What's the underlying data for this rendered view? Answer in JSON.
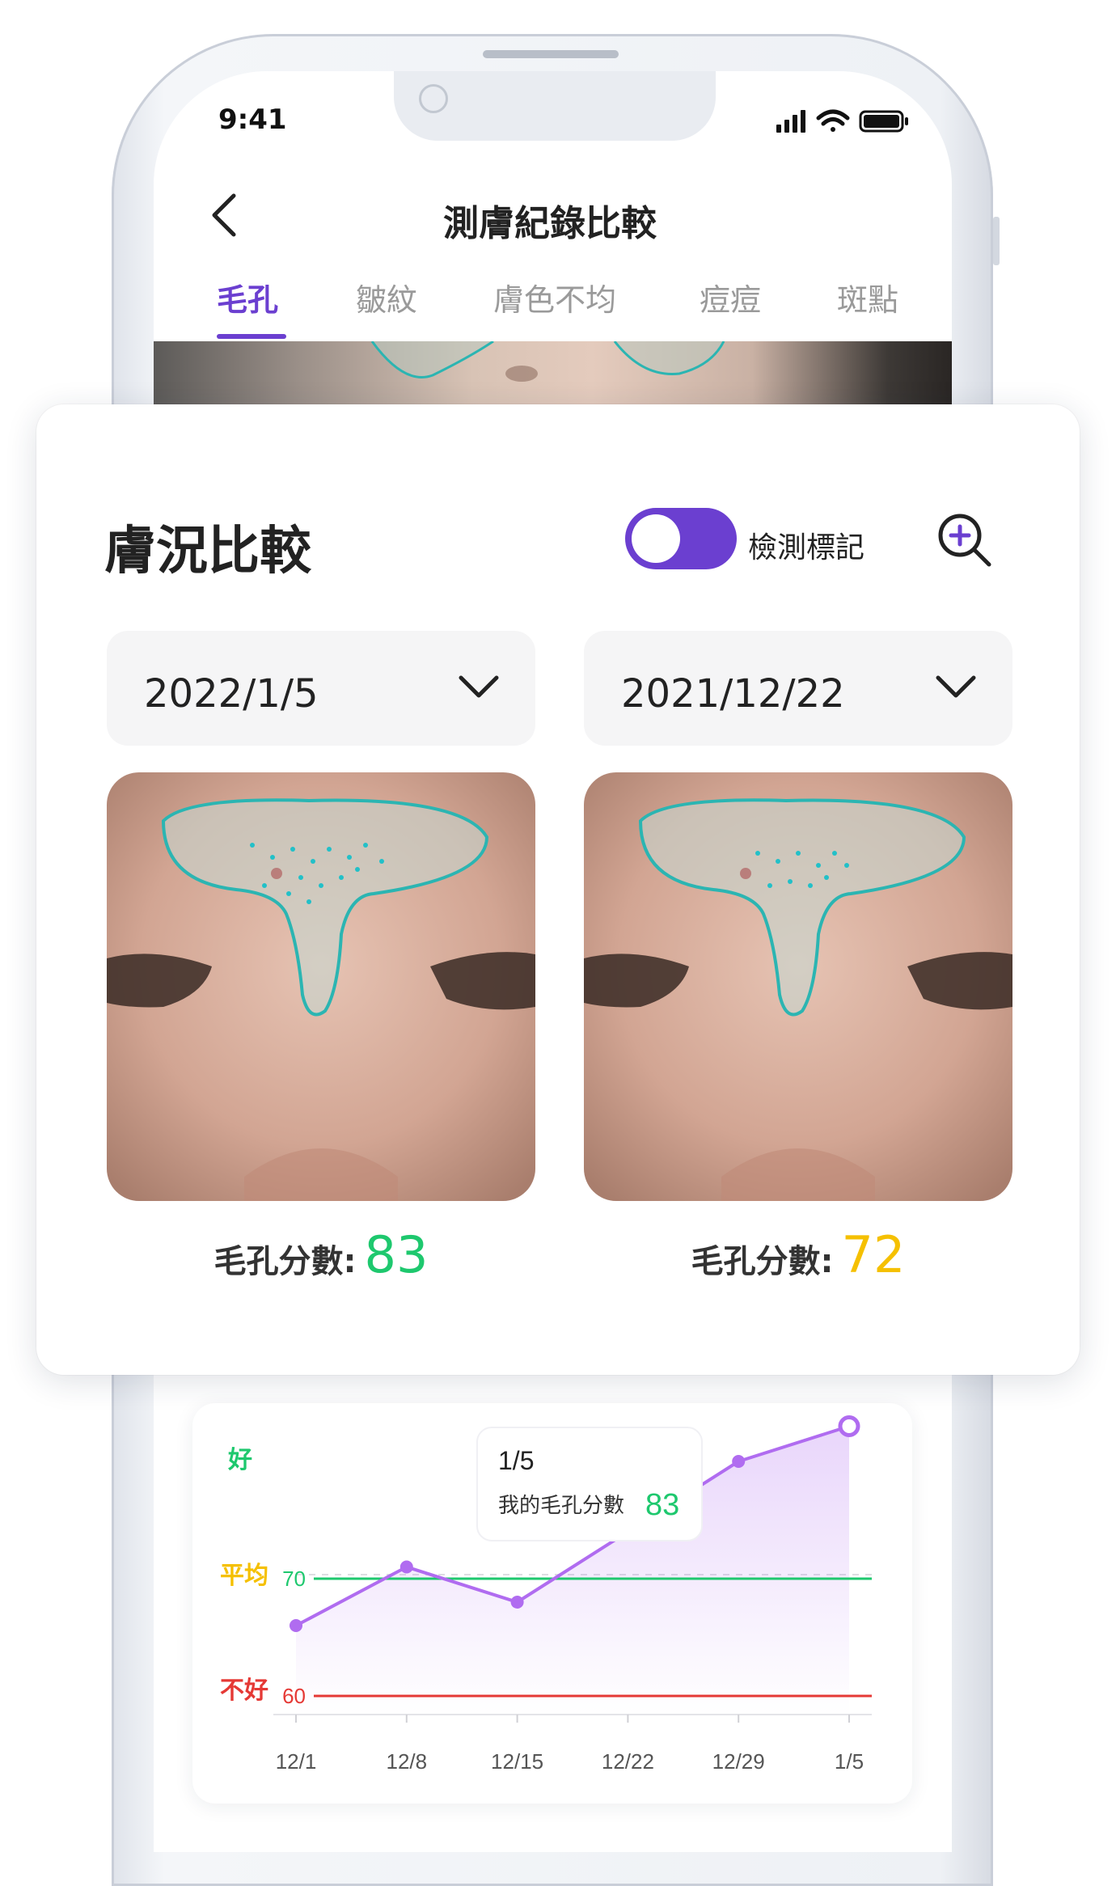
{
  "status_bar": {
    "time": "9:41"
  },
  "nav": {
    "title": "測膚紀錄比較"
  },
  "tabs": [
    {
      "label": "毛孔",
      "active": true
    },
    {
      "label": "皺紋",
      "active": false
    },
    {
      "label": "膚色不均",
      "active": false
    },
    {
      "label": "痘痘",
      "active": false
    },
    {
      "label": "斑點",
      "active": false
    }
  ],
  "comparison": {
    "title": "膚況比較",
    "toggle_label": "檢測標記",
    "toggle_on": true,
    "left": {
      "date": "2022/1/5",
      "score_label": "毛孔分數:",
      "score": "83",
      "score_color": "#1ec86e"
    },
    "right": {
      "date": "2021/12/22",
      "score_label": "毛孔分數:",
      "score": "72",
      "score_color": "#f5c000"
    }
  },
  "chart_data": {
    "type": "line",
    "x": [
      "12/1",
      "12/8",
      "12/15",
      "12/22",
      "12/29",
      "1/5"
    ],
    "series": [
      {
        "values": [
          66,
          71,
          68,
          74,
          80,
          83
        ]
      }
    ],
    "band_labels": {
      "good": "好",
      "average": "平均",
      "bad": "不好"
    },
    "reference_lines": [
      {
        "value": 70,
        "label": "70",
        "color": "#1ec86e"
      },
      {
        "value": 60,
        "label": "60",
        "color": "#e53935"
      }
    ],
    "tooltip": {
      "date": "1/5",
      "label": "我的毛孔分數",
      "value": "83"
    },
    "colors": {
      "line": "#b06cf0",
      "good": "#1ec86e",
      "average": "#f5c000",
      "bad": "#e53935"
    }
  }
}
